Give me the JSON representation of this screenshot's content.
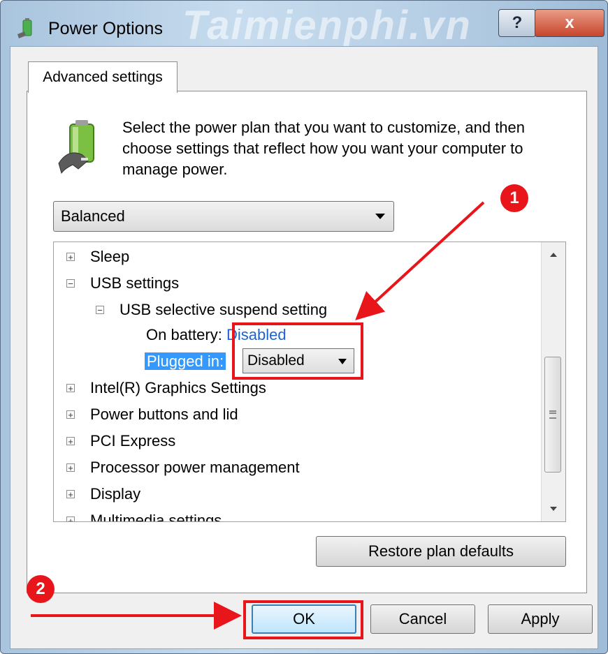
{
  "window": {
    "title": "Power Options",
    "watermark": "Taimienphi.vn",
    "help_label": "?",
    "close_label": "x"
  },
  "tab": {
    "label": "Advanced settings"
  },
  "description": "Select the power plan that you want to customize, and then choose settings that reflect how you want your computer to manage power.",
  "plan_select": {
    "value": "Balanced"
  },
  "tree": {
    "sleep": "Sleep",
    "usb": "USB settings",
    "usb_suspend": "USB selective suspend setting",
    "on_battery_label": "On battery:",
    "on_battery_value": "Disabled",
    "plugged_in_label": "Plugged in:",
    "plugged_in_value": "Disabled",
    "intel": "Intel(R) Graphics Settings",
    "power_buttons": "Power buttons and lid",
    "pci": "PCI Express",
    "processor": "Processor power management",
    "display": "Display",
    "multimedia": "Multimedia settings"
  },
  "buttons": {
    "restore": "Restore plan defaults",
    "ok": "OK",
    "cancel": "Cancel",
    "apply": "Apply"
  },
  "annotations": {
    "badge_1": "1",
    "badge_2": "2",
    "color": "#e8151b"
  }
}
